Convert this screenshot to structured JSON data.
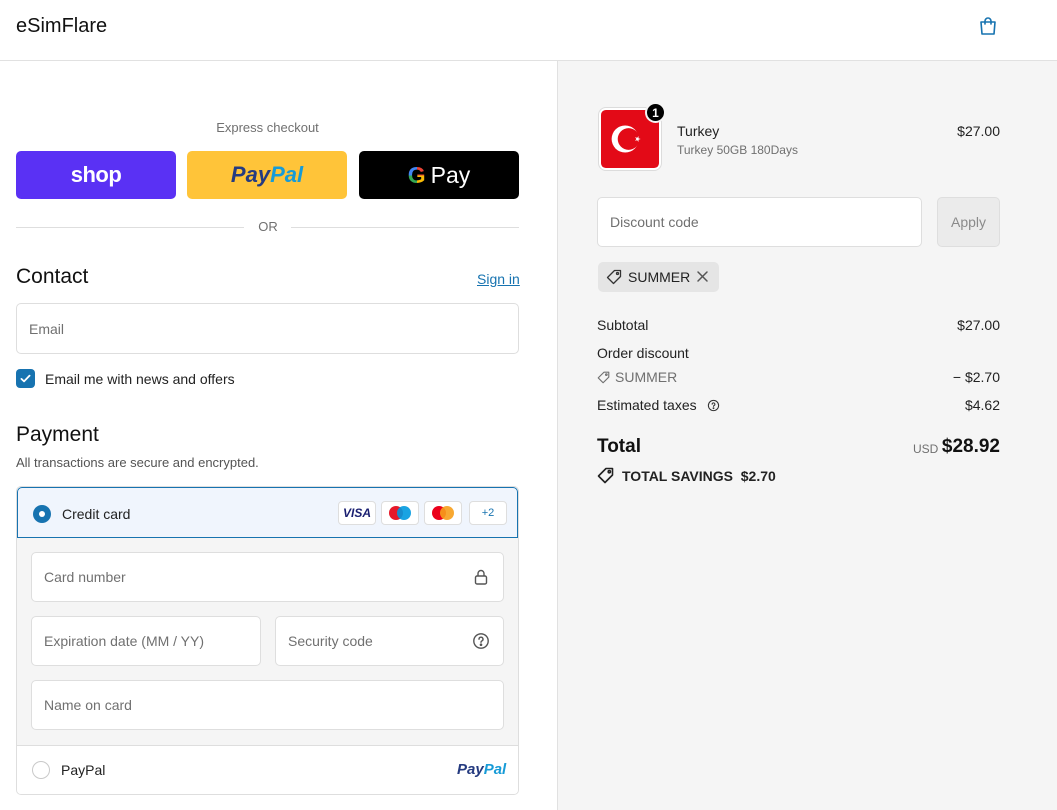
{
  "header": {
    "brand": "eSimFlare",
    "cart_icon": "shopping-bag-icon"
  },
  "express": {
    "label": "Express checkout",
    "shop": "shop",
    "paypal_a": "Pay",
    "paypal_b": "Pal",
    "gpay_g": "G",
    "gpay_text": "Pay",
    "or": "OR"
  },
  "contact": {
    "title": "Contact",
    "signin": "Sign in",
    "email_placeholder": "Email",
    "newsletter_label": "Email me with news and offers",
    "newsletter_checked": true
  },
  "payment": {
    "title": "Payment",
    "subtitle": "All transactions are secure and encrypted.",
    "credit_card_label": "Credit card",
    "card_brands": [
      "VISA",
      "maestro",
      "mastercard"
    ],
    "visa": "VISA",
    "more_brands": "+2",
    "card_number_placeholder": "Card number",
    "expiration_placeholder": "Expiration date (MM / YY)",
    "security_placeholder": "Security code",
    "name_placeholder": "Name on card",
    "paypal_label": "PayPal",
    "paypal_logo_a": "Pay",
    "paypal_logo_b": "Pal"
  },
  "summary": {
    "product": {
      "name": "Turkey",
      "variant": "Turkey 50GB 180Days",
      "price": "$27.00",
      "quantity": "1"
    },
    "discount_placeholder": "Discount code",
    "apply": "Apply",
    "applied_code": "SUMMER",
    "subtotal_label": "Subtotal",
    "subtotal": "$27.00",
    "order_discount_label": "Order discount",
    "discount_code": "SUMMER",
    "discount_amount": "− $2.70",
    "taxes_label": "Estimated taxes",
    "taxes": "$4.62",
    "total_label": "Total",
    "currency": "USD",
    "total": "$28.92",
    "savings": "TOTAL SAVINGS  $2.70"
  },
  "colors": {
    "accent": "#1773b0",
    "shop": "#5a31f4",
    "paypal": "#ffc439",
    "gpay": "#000000"
  }
}
